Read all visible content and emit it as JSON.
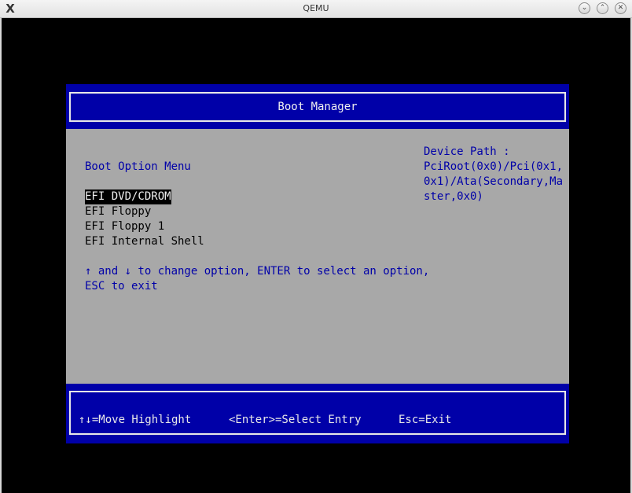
{
  "window": {
    "title": "QEMU",
    "app_icon": "X",
    "buttons": {
      "minimize": "⌄",
      "maximize": "⌃",
      "close": "✕"
    }
  },
  "header": {
    "title": "Boot Manager"
  },
  "menu": {
    "title": "Boot Option Menu",
    "items": [
      {
        "label": "EFI DVD/CDROM",
        "selected": true
      },
      {
        "label": "EFI Floppy",
        "selected": false
      },
      {
        "label": "EFI Floppy 1",
        "selected": false
      },
      {
        "label": "EFI Internal Shell",
        "selected": false
      }
    ],
    "help_line1": "↑ and ↓ to change option, ENTER to select an option,",
    "help_line2": "ESC to exit"
  },
  "device_path": {
    "label": "Device Path :",
    "value": "PciRoot(0x0)/Pci(0x1,0x1)/Ata(Secondary,Master,0x0)"
  },
  "footer": {
    "move": "↑↓=Move Highlight",
    "select": "<Enter>=Select Entry",
    "exit": "Esc=Exit"
  },
  "colors": {
    "efi_blue": "#0000a8",
    "panel_gray": "#a8a8a8"
  }
}
